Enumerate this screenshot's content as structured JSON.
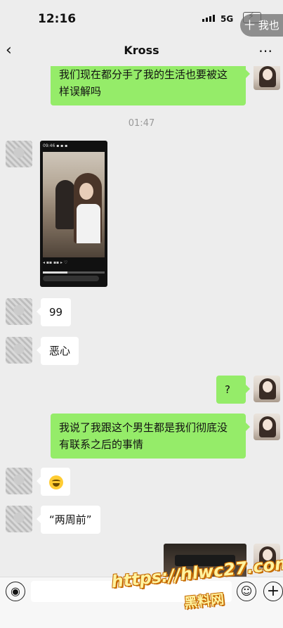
{
  "status_bar": {
    "time": "12:16",
    "network": "5G",
    "float_tag": "十 我也"
  },
  "header": {
    "title": "Kross",
    "more_icon": "⋯",
    "back_icon": "‹"
  },
  "messages": [
    {
      "from": "me",
      "text": "我们现在都分手了我的生活也要被这样误解吗"
    },
    {
      "type": "timestamp",
      "text": "01:47"
    },
    {
      "from": "other",
      "type": "video"
    },
    {
      "from": "other",
      "text": "99"
    },
    {
      "from": "other",
      "text": "恶心"
    },
    {
      "from": "me",
      "text": "?"
    },
    {
      "from": "me",
      "text": "我说了我跟这个男生都是我们彻底没有联系之后的事情"
    },
    {
      "from": "other",
      "type": "emoji",
      "icon": "grin-sweat-emoji"
    },
    {
      "from": "other",
      "text": "“两周前”"
    },
    {
      "from": "me",
      "type": "image"
    }
  ],
  "msg1_line1": "我们现在都分手了我的生活也要被这",
  "msg1_line2": "样误解吗",
  "msg7_line1": "我说了我跟这个男生都是我们彻底没",
  "msg7_line2": "有联系之后的事情",
  "watermark": {
    "url": "https://hlwc27.com",
    "name": "黑料网"
  }
}
